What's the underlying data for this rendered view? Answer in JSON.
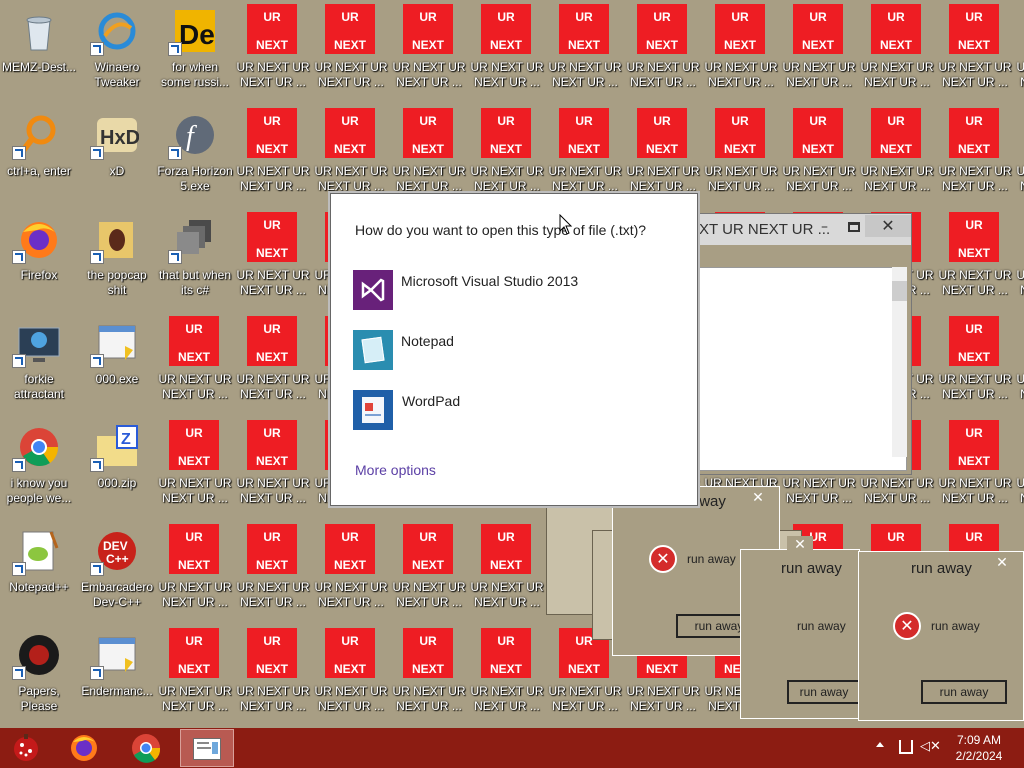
{
  "desktop": {
    "icons": [
      {
        "label": "MEMZ-Dest...",
        "icon": "recycle-bin-icon"
      },
      {
        "label": "Winaero Tweaker",
        "icon": "winaero-icon"
      },
      {
        "label": "for when some russi...",
        "icon": "de-icon"
      },
      {
        "label": "ctrl+a, enter",
        "icon": "magnifier-icon"
      },
      {
        "label": "xD",
        "icon": "hxd-icon"
      },
      {
        "label": "Forza Horizon 5.exe",
        "icon": "flash-icon"
      },
      {
        "label": "Firefox",
        "icon": "firefox-icon"
      },
      {
        "label": "the popcap shit",
        "icon": "folder-icon"
      },
      {
        "label": "that but when its c#",
        "icon": "stack-icon"
      },
      {
        "label": "forkie attractant",
        "icon": "computer-gear-icon"
      },
      {
        "label": "000.exe",
        "icon": "exe-icon"
      },
      {
        "label": "i know you people we...",
        "icon": "chrome-icon"
      },
      {
        "label": "000.zip",
        "icon": "zip-icon"
      },
      {
        "label": "Notepad++",
        "icon": "notepadpp-icon"
      },
      {
        "label": "Embarcadero Dev-C++",
        "icon": "devcpp-icon"
      },
      {
        "label": "Papers, Please",
        "icon": "papers-icon"
      },
      {
        "label": "Endermanc...",
        "icon": "exe-icon"
      }
    ],
    "ur_tile": {
      "top_text": "UR",
      "bottom_text": "NEXT",
      "label": "UR NEXT UR NEXT UR ..."
    }
  },
  "open_with": {
    "title": "How do you want to open this type of file (.txt)?",
    "apps": [
      {
        "name": "Microsoft Visual Studio 2013",
        "icon": "visual-studio-icon"
      },
      {
        "name": "Notepad",
        "icon": "notepad-icon"
      },
      {
        "name": "WordPad",
        "icon": "wordpad-icon"
      }
    ],
    "more": "More options"
  },
  "notepad_window": {
    "title": "XT UR NEXT UR ..."
  },
  "msg_boxes": {
    "title": "run away",
    "message": "run away",
    "button": "run away"
  },
  "taskbar": {
    "time": "7:09 AM",
    "date": "2/2/2024"
  },
  "colors": {
    "desktop_bg": "#a89e84",
    "tile_red": "#ee1d23",
    "taskbar": "#8c1c12",
    "link": "#5b3fa5"
  }
}
